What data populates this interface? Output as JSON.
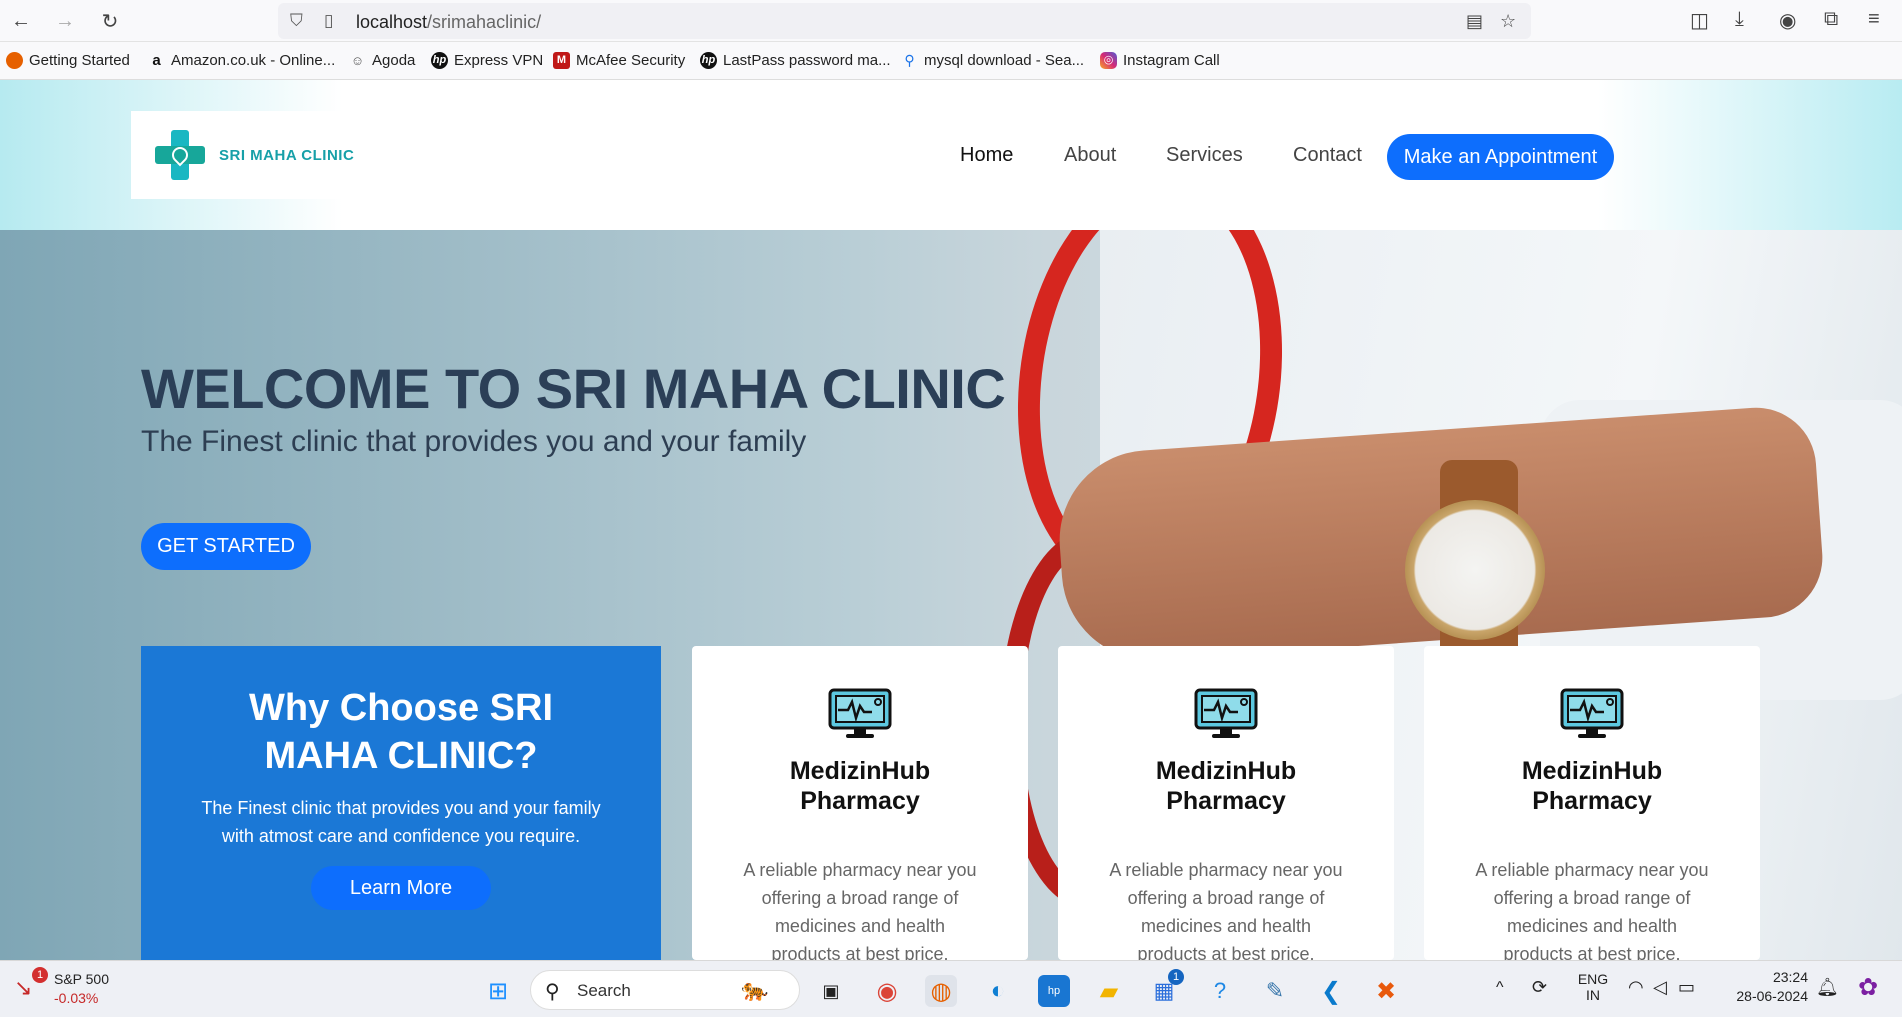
{
  "browser": {
    "url_host": "localhost",
    "url_path": "/srimahaclinic/",
    "bookmarks": [
      {
        "label": "Getting Started",
        "icon": "firefox-icon",
        "color": "#e66000"
      },
      {
        "label": "Amazon.co.uk - Online...",
        "icon": "amazon-icon",
        "color": "#111111"
      },
      {
        "label": "Agoda",
        "icon": "agoda-icon",
        "color": "#555555"
      },
      {
        "label": "Express VPN",
        "icon": "hp-icon",
        "color": "#111111"
      },
      {
        "label": "McAfee Security",
        "icon": "mcafee-icon",
        "color": "#c01818"
      },
      {
        "label": "LastPass password ma...",
        "icon": "hp-icon",
        "color": "#111111"
      },
      {
        "label": "mysql download - Sea...",
        "icon": "search-icon",
        "color": "#1a73e8"
      },
      {
        "label": "Instagram Call",
        "icon": "instagram-icon",
        "color": "#d62976"
      }
    ]
  },
  "site": {
    "logo_text": "SRI MAHA CLINIC",
    "nav": [
      {
        "label": "Home",
        "active": true
      },
      {
        "label": "About",
        "active": false
      },
      {
        "label": "Services",
        "active": false
      },
      {
        "label": "Contact",
        "active": false
      }
    ],
    "appointment_label": "Make an Appointment",
    "hero": {
      "title": "WELCOME TO SRI MAHA CLINIC",
      "subtitle": "The Finest clinic that provides you and your family",
      "cta": "GET STARTED"
    },
    "why": {
      "title": "Why Choose SRI MAHA CLINIC?",
      "text": "The Finest clinic that provides you and your family with atmost care and confidence you require.",
      "button": "Learn More"
    },
    "services": [
      {
        "title": "MedizinHub Pharmacy",
        "text": "A reliable pharmacy near you offering a broad range of medicines and health products at best price."
      },
      {
        "title": "MedizinHub Pharmacy",
        "text": "A reliable pharmacy near you offering a broad range of medicines and health products at best price."
      },
      {
        "title": "MedizinHub Pharmacy",
        "text": "A reliable pharmacy near you offering a broad range of medicines and health products at best price."
      }
    ]
  },
  "taskbar": {
    "stock_name": "S&P 500",
    "stock_change": "-0.03%",
    "stock_badge": "1",
    "search_label": "Search",
    "store_badge": "1",
    "lang_top": "ENG",
    "lang_bottom": "IN",
    "time": "23:24",
    "date": "28-06-2024"
  },
  "colors": {
    "primary": "#0d6efd",
    "why_card": "#1b78d6",
    "logo_teal": "#17a0a8",
    "hero_title": "#2b3f57"
  }
}
